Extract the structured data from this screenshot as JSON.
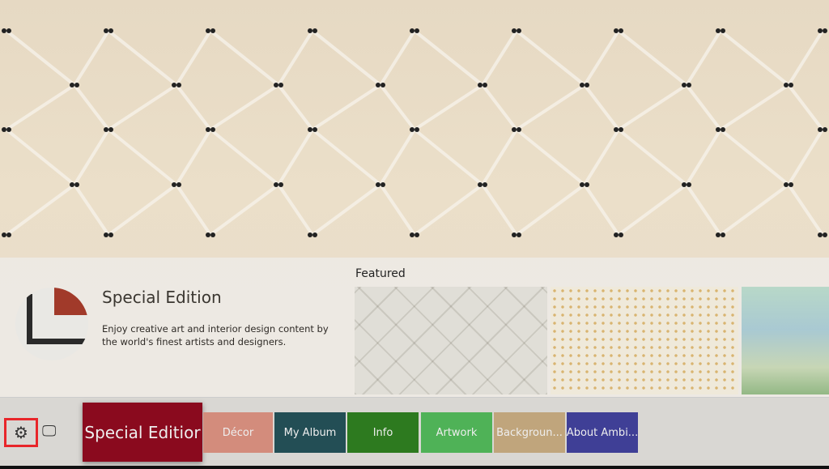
{
  "featured": {
    "label": "Featured"
  },
  "info": {
    "title": "Special Edition",
    "description": "Enjoy creative art and interior design content by the world's finest artists and designers."
  },
  "toolbar": {
    "settings_icon": "gear-icon",
    "tv_icon": "tv-icon"
  },
  "categories": [
    {
      "label": "Special Editior",
      "color": "#8a0a1e"
    },
    {
      "label": "Décor",
      "color": "#d38c7c"
    },
    {
      "label": "My Album",
      "color": "#234e55"
    },
    {
      "label": "Info",
      "color": "#2d7a1f"
    },
    {
      "label": "Artwork",
      "color": "#4fb257"
    },
    {
      "label": "Backgroun...",
      "color": "#c0a57c"
    },
    {
      "label": "About Ambi...",
      "color": "#3f3f96"
    }
  ],
  "highlight_color": "#e8262a"
}
